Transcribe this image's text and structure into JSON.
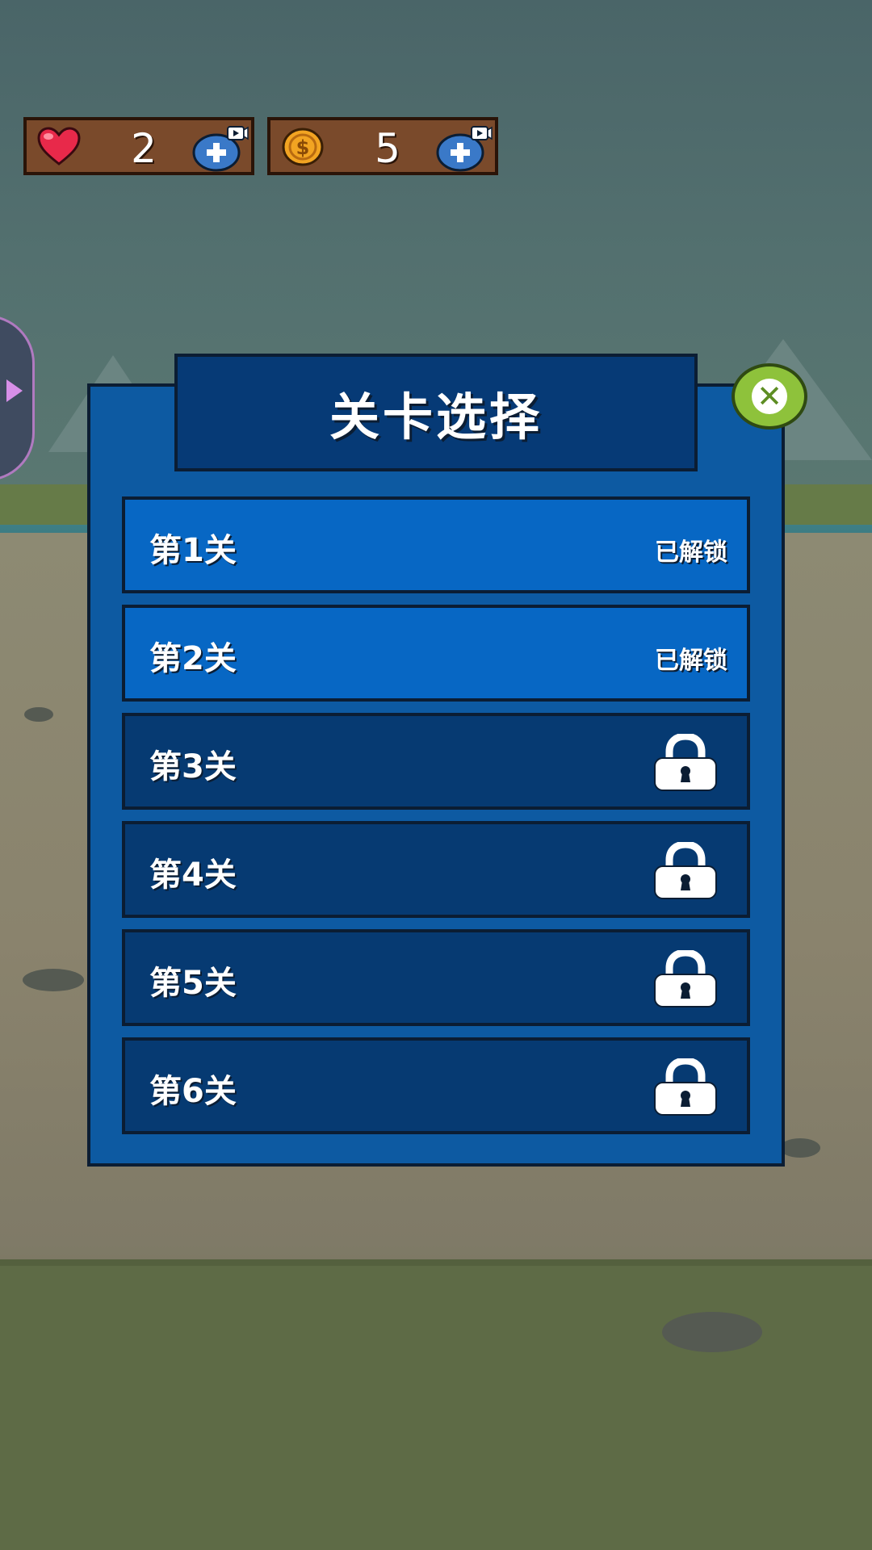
{
  "resources": {
    "lives": {
      "value": "2",
      "icon": "heart-icon"
    },
    "coins": {
      "value": "5",
      "icon": "coin-icon"
    }
  },
  "dialog": {
    "title": "关卡选择",
    "close_icon": "close-icon"
  },
  "levels": [
    {
      "name": "第1关",
      "status": "已解锁",
      "locked": false
    },
    {
      "name": "第2关",
      "status": "已解锁",
      "locked": false
    },
    {
      "name": "第3关",
      "status": "",
      "locked": true
    },
    {
      "name": "第4关",
      "status": "",
      "locked": true
    },
    {
      "name": "第5关",
      "status": "",
      "locked": true
    },
    {
      "name": "第6关",
      "status": "",
      "locked": true
    }
  ],
  "colors": {
    "panel": "#0d5aa2",
    "unlocked_row": "#0767c4",
    "locked_row": "#063a72",
    "close_button": "#8ec23b",
    "resource_bar": "#7a4a2b"
  }
}
